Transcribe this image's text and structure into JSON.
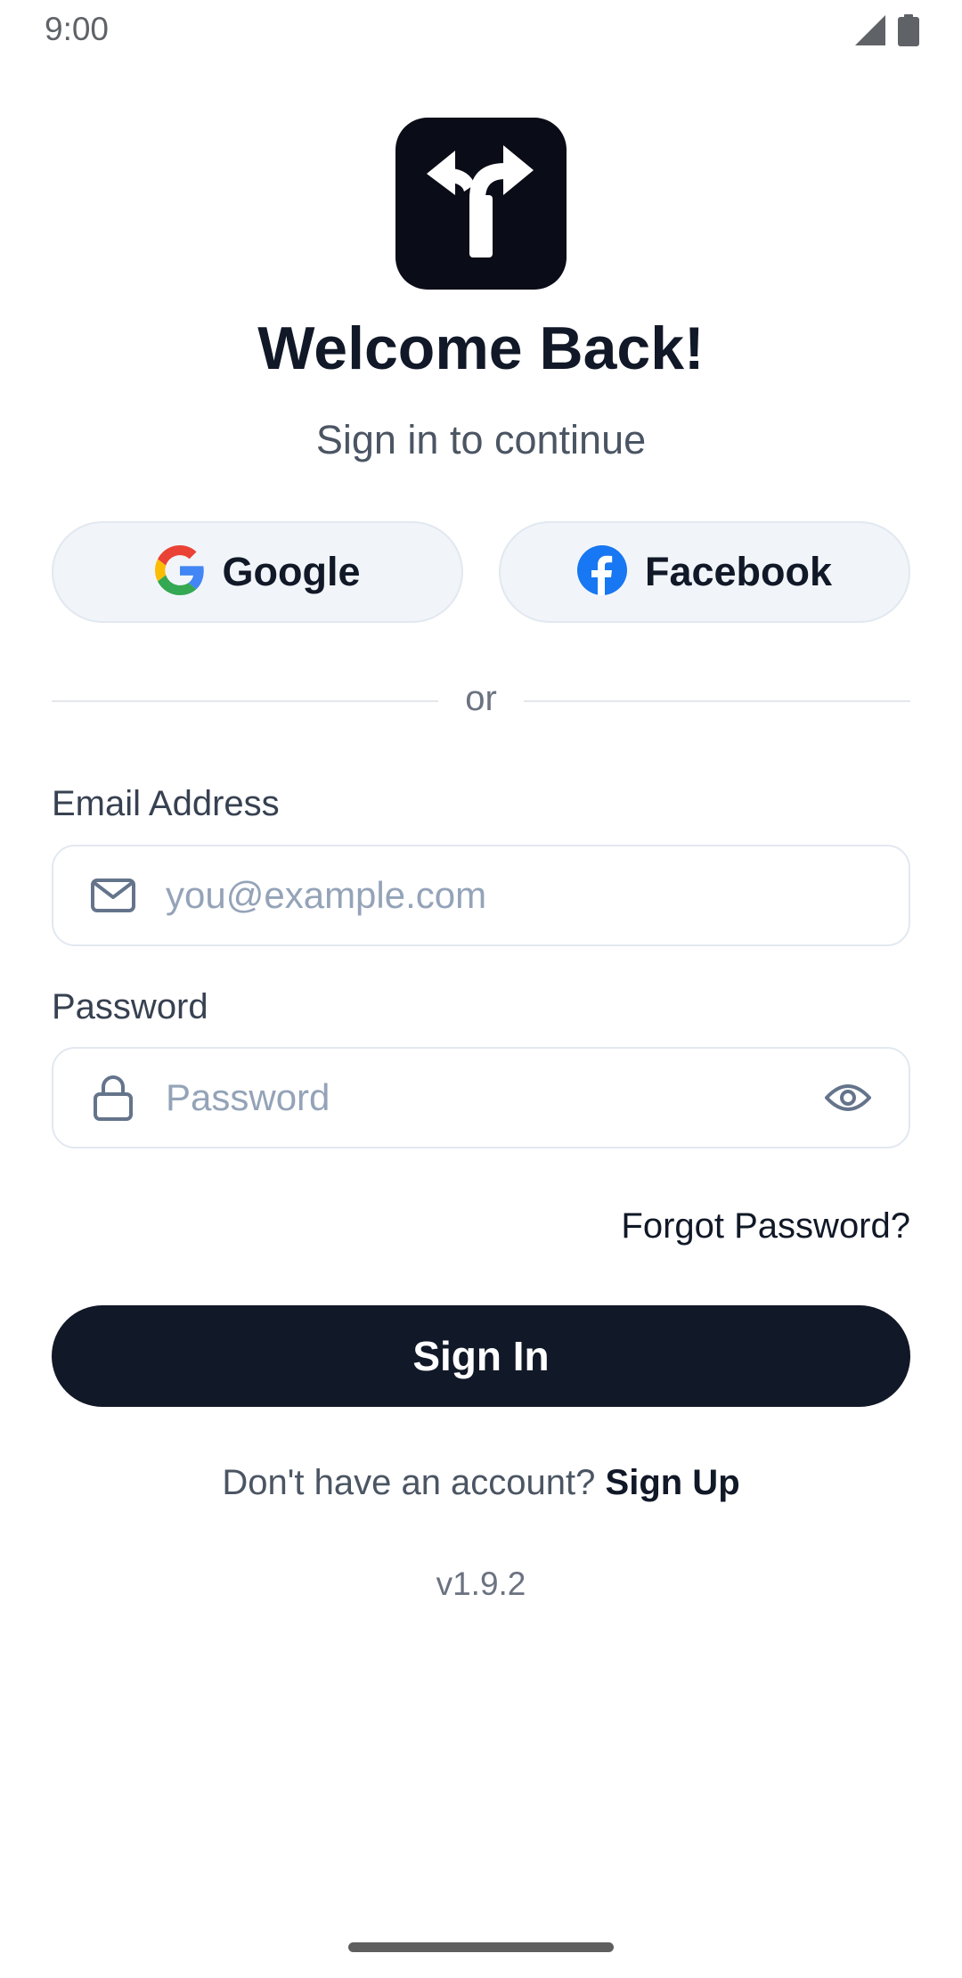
{
  "status_bar": {
    "time": "9:00",
    "icons": [
      "signal-icon",
      "battery-icon"
    ]
  },
  "header": {
    "logo_icon": "split-arrow-icon",
    "title": "Welcome Back!",
    "subtitle": "Sign in to continue"
  },
  "social": {
    "google_label": "Google",
    "facebook_label": "Facebook"
  },
  "divider": {
    "text": "or"
  },
  "form": {
    "email_label": "Email Address",
    "email_placeholder": "you@example.com",
    "email_value": "",
    "password_label": "Password",
    "password_placeholder": "Password",
    "password_value": "",
    "forgot_label": "Forgot Password?",
    "submit_label": "Sign In"
  },
  "footer": {
    "signup_prompt": "Don't have an account?",
    "signup_label": "Sign Up",
    "version": "v1.9.2"
  },
  "colors": {
    "primary": "#111827",
    "logo_bg": "#0a0c17",
    "social_bg": "#f1f5f9",
    "facebook": "#1877f2"
  }
}
